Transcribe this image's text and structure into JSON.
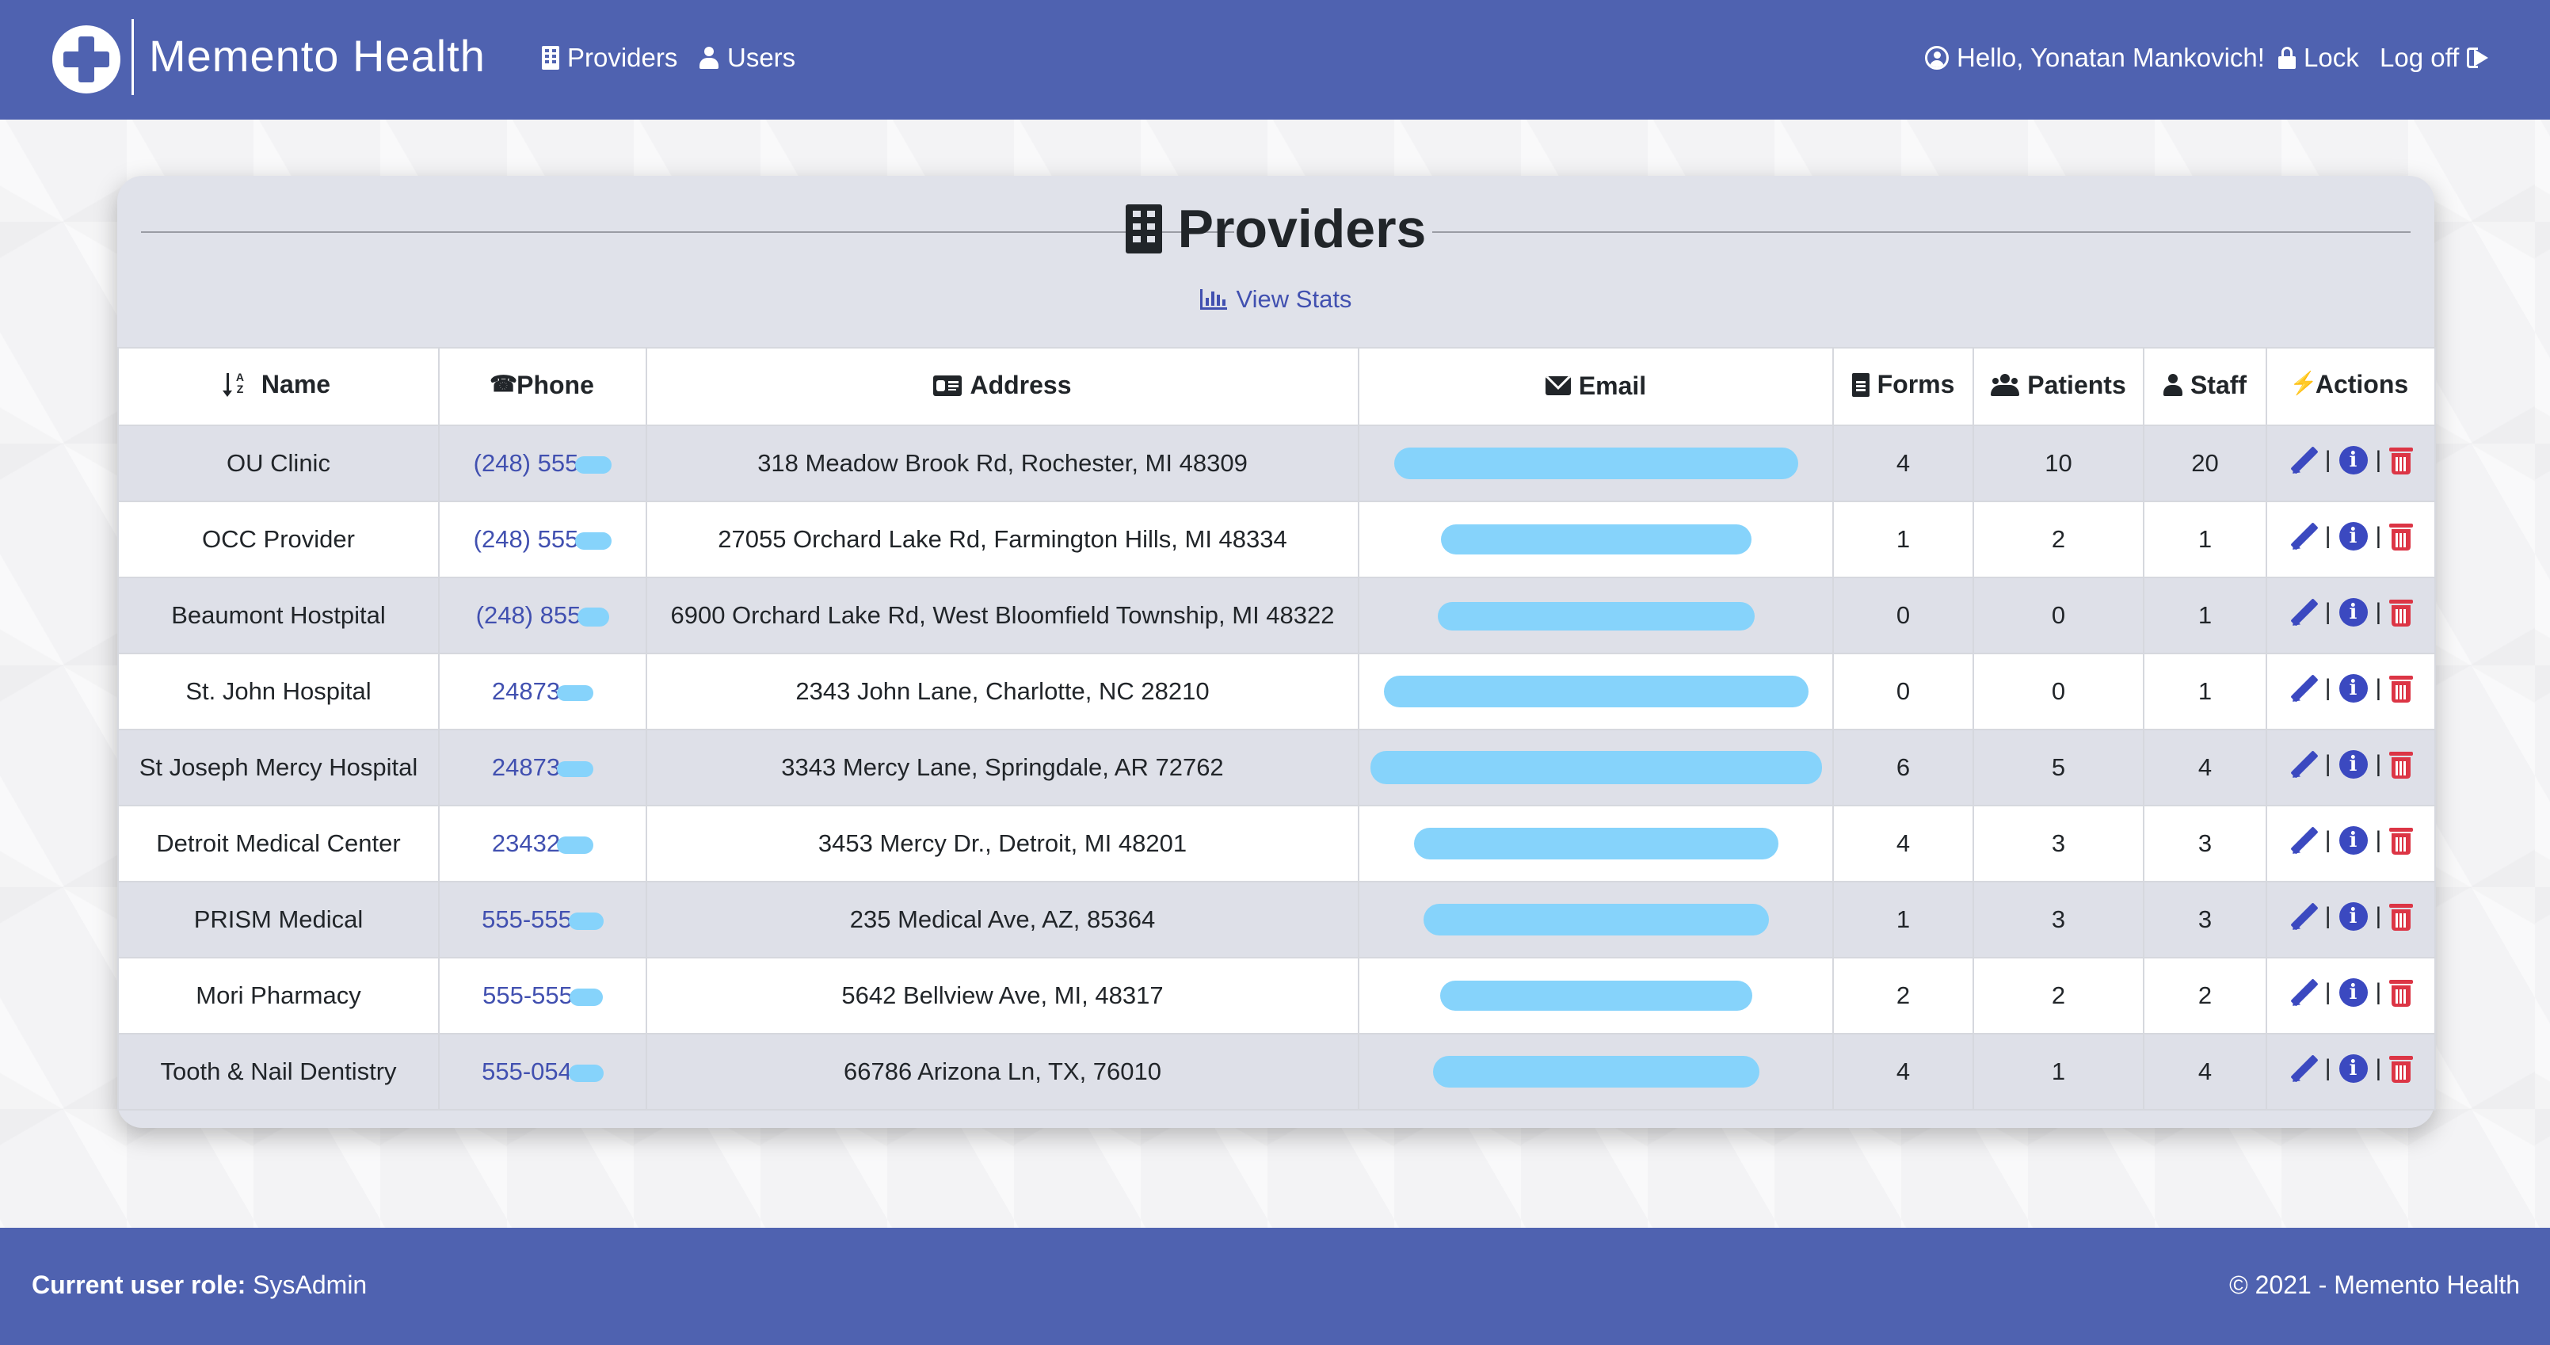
{
  "app": {
    "brand_name": "Memento Health",
    "nav": {
      "providers": "Providers",
      "users": "Users",
      "greeting": "Hello, Yonatan Mankovich!",
      "lock": "Lock",
      "logoff": "Log off"
    }
  },
  "page": {
    "title": "Providers",
    "view_stats": "View Stats"
  },
  "table": {
    "headers": {
      "name": "Name",
      "phone": "Phone",
      "address": "Address",
      "email": "Email",
      "forms": "Forms",
      "patients": "Patients",
      "staff": "Staff",
      "actions": "Actions"
    },
    "rows": [
      {
        "name": "OU Clinic",
        "phone": "(248) 555",
        "address": "318 Meadow Brook Rd, Rochester, MI 48309",
        "forms": "4",
        "patients": "10",
        "staff": "20"
      },
      {
        "name": "OCC Provider",
        "phone": "(248) 555",
        "address": "27055 Orchard Lake Rd, Farmington Hills, MI 48334",
        "forms": "1",
        "patients": "2",
        "staff": "1"
      },
      {
        "name": "Beaumont Hostpital",
        "phone": "(248) 855",
        "address": "6900 Orchard Lake Rd, West Bloomfield Township, MI 48322",
        "forms": "0",
        "patients": "0",
        "staff": "1"
      },
      {
        "name": "St. John Hospital",
        "phone": "24873",
        "address": "2343 John Lane, Charlotte, NC 28210",
        "forms": "0",
        "patients": "0",
        "staff": "1"
      },
      {
        "name": "St Joseph Mercy Hospital",
        "phone": "24873",
        "address": "3343 Mercy Lane, Springdale, AR 72762",
        "forms": "6",
        "patients": "5",
        "staff": "4"
      },
      {
        "name": "Detroit Medical Center",
        "phone": "23432",
        "address": "3453 Mercy Dr., Detroit, MI 48201",
        "forms": "4",
        "patients": "3",
        "staff": "3"
      },
      {
        "name": "PRISM Medical",
        "phone": "555-555",
        "address": "235 Medical Ave, AZ, 85364",
        "forms": "1",
        "patients": "3",
        "staff": "3"
      },
      {
        "name": "Mori Pharmacy",
        "phone": "555-555",
        "address": "5642 Bellview Ave, MI, 48317",
        "forms": "2",
        "patients": "2",
        "staff": "2"
      },
      {
        "name": "Tooth & Nail Dentistry",
        "phone": "555-054",
        "address": "66786 Arizona Ln, TX, 76010",
        "forms": "4",
        "patients": "1",
        "staff": "4"
      }
    ]
  },
  "footer": {
    "role_label": "Current user role:",
    "role_value": "SysAdmin",
    "copyright": "© 2021 - Memento Health"
  },
  "colors": {
    "brand": "#4f62b0",
    "link": "#4150b0",
    "redaction": "#86d3fb",
    "delete": "#dc3545"
  }
}
